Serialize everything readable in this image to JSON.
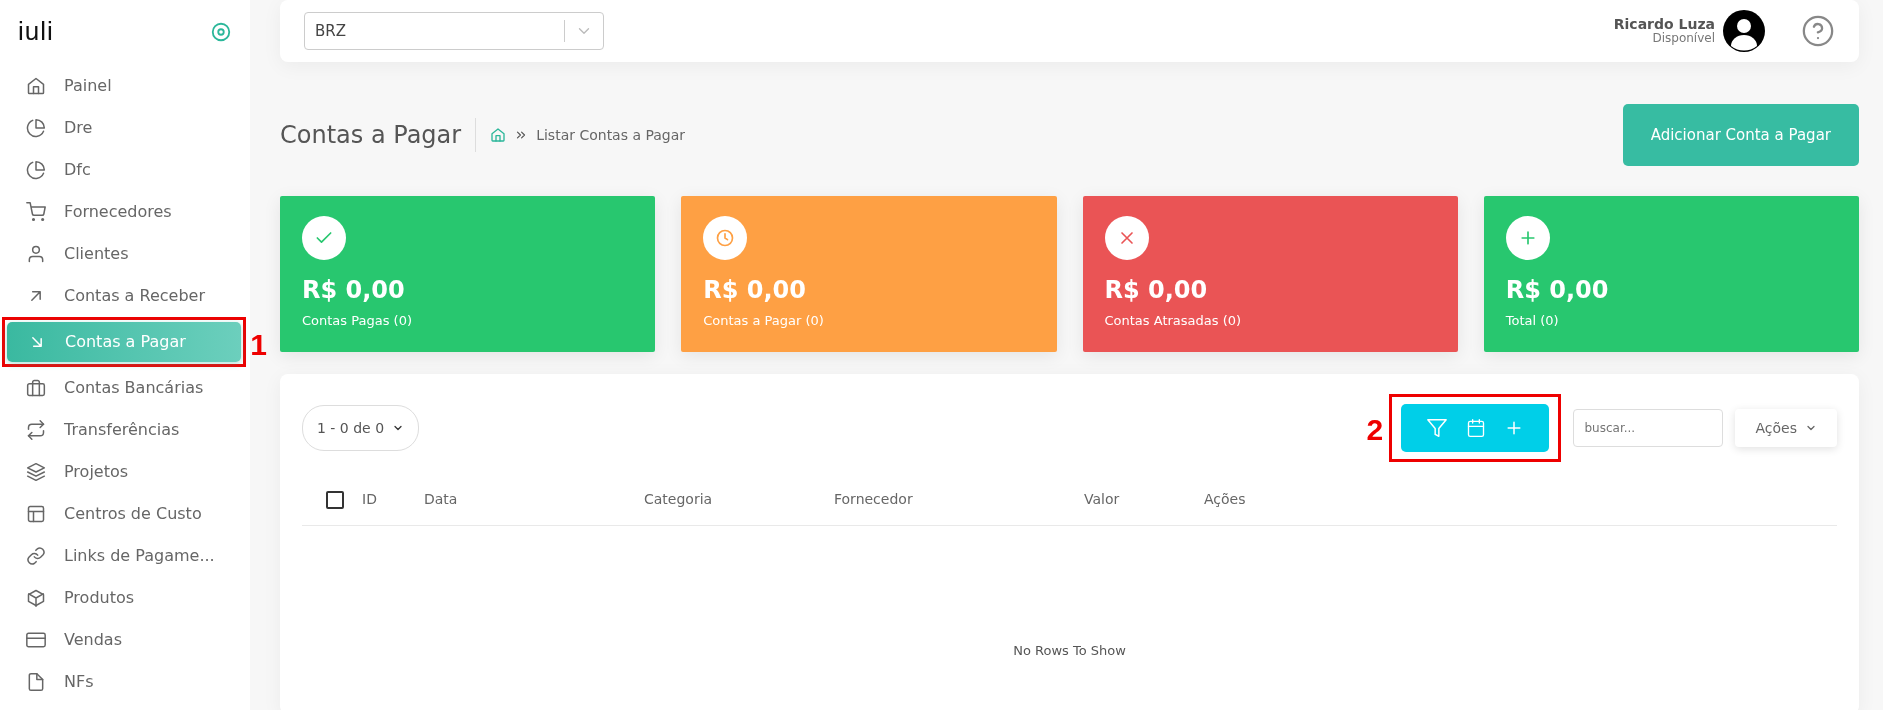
{
  "sidebar": {
    "logo": "iuli",
    "items": [
      {
        "label": "Painel",
        "selected": false
      },
      {
        "label": "Dre",
        "selected": false
      },
      {
        "label": "Dfc",
        "selected": false
      },
      {
        "label": "Fornecedores",
        "selected": false
      },
      {
        "label": "Clientes",
        "selected": false
      },
      {
        "label": "Contas a Receber",
        "selected": false
      },
      {
        "label": "Contas a Pagar",
        "selected": true,
        "annotation": "1"
      },
      {
        "label": "Contas Bancárias",
        "selected": false
      },
      {
        "label": "Transferências",
        "selected": false
      },
      {
        "label": "Projetos",
        "selected": false
      },
      {
        "label": "Centros de Custo",
        "selected": false
      },
      {
        "label": "Links de Pagame...",
        "selected": false
      },
      {
        "label": "Produtos",
        "selected": false
      },
      {
        "label": "Vendas",
        "selected": false
      },
      {
        "label": "NFs",
        "selected": false
      }
    ]
  },
  "header": {
    "company_select": "BRZ",
    "user": {
      "name": "Ricardo Luza",
      "status": "Disponível"
    }
  },
  "page": {
    "title": "Contas a Pagar",
    "breadcrumb": "Listar Contas a Pagar",
    "add_button": "Adicionar Conta a Pagar"
  },
  "cards": [
    {
      "amount": "R$ 0,00",
      "label": "Contas Pagas (0)",
      "color": "#28c76f"
    },
    {
      "amount": "R$ 0,00",
      "label": "Contas a Pagar (0)",
      "color": "#fea044"
    },
    {
      "amount": "R$ 0,00",
      "label": "Contas Atrasadas (0)",
      "color": "#ea5455"
    },
    {
      "amount": "R$ 0,00",
      "label": "Total (0)",
      "color": "#28c76f"
    }
  ],
  "table": {
    "pager": "1 - 0 de 0",
    "filter_annotation": "2",
    "search": {
      "placeholder": "buscar..."
    },
    "actions_button": "Ações",
    "select_all_checked": false,
    "columns": [
      "ID",
      "Data",
      "Categoria",
      "Fornecedor",
      "Valor",
      "Ações"
    ],
    "empty_message": "No Rows To Show"
  }
}
